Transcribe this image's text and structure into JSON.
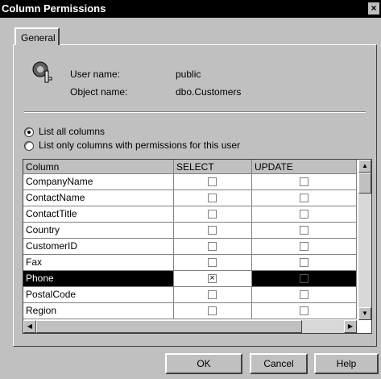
{
  "window": {
    "title": "Column Permissions",
    "close_label": "×"
  },
  "tabs": [
    {
      "label": "General"
    }
  ],
  "info": {
    "user_label": "User name:",
    "user_value": "public",
    "object_label": "Object name:",
    "object_value": "dbo.Customers"
  },
  "options": [
    {
      "label": "List all columns",
      "checked": true
    },
    {
      "label": "List only columns with permissions for this user",
      "checked": false
    }
  ],
  "grid": {
    "columns": [
      "Column",
      "SELECT",
      "UPDATE"
    ],
    "rows": [
      {
        "name": "CompanyName",
        "select": "",
        "update": ""
      },
      {
        "name": "ContactName",
        "select": "",
        "update": ""
      },
      {
        "name": "ContactTitle",
        "select": "",
        "update": ""
      },
      {
        "name": "Country",
        "select": "",
        "update": ""
      },
      {
        "name": "CustomerID",
        "select": "",
        "update": ""
      },
      {
        "name": "Fax",
        "select": "",
        "update": ""
      },
      {
        "name": "Phone",
        "select": "×",
        "update": ""
      },
      {
        "name": "PostalCode",
        "select": "",
        "update": ""
      },
      {
        "name": "Region",
        "select": "",
        "update": ""
      }
    ]
  },
  "buttons": {
    "ok": "OK",
    "cancel": "Cancel",
    "help": "Help"
  }
}
